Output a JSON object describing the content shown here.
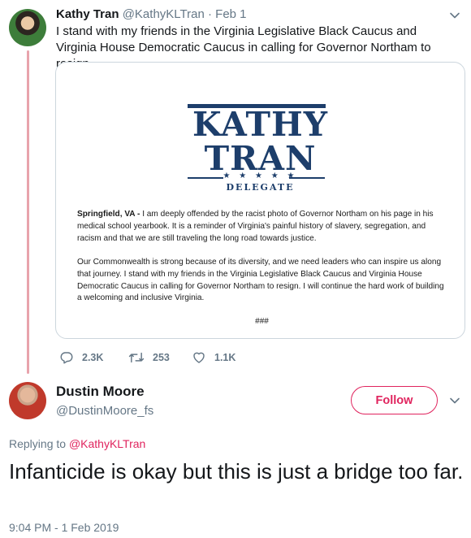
{
  "parent_tweet": {
    "author_name": "Kathy Tran",
    "author_handle": "@KathyKLTran",
    "separator": "·",
    "date": "Feb 1",
    "text": "I stand with my friends in the Virginia Legislative Black Caucus and Virginia House Democratic Caucus in calling for Governor Northam to resign.",
    "media": {
      "logo_line1": "KATHY",
      "logo_line2": "TRAN",
      "logo_stars": "★ ★ ★ ★ ★",
      "logo_subtitle": "DELEGATE",
      "dateline": "Springfield, VA -",
      "paragraph1": "I am deeply offended by the racist photo of Governor Northam on his page in his medical school yearbook. It is a reminder of Virginia's painful history of slavery, segregation, and racism and that we are still traveling the long road towards justice.",
      "paragraph2": "Our Commonwealth is strong because of its diversity, and we need leaders who can inspire us along that journey. I stand with my friends in the Virginia Legislative Black Caucus and Virginia House Democratic Caucus in calling for Governor Northam to resign. I will continue the hard work of building a welcoming and inclusive Virginia.",
      "end_mark": "###"
    },
    "actions": {
      "replies": "2.3K",
      "retweets": "253",
      "likes": "1.1K"
    }
  },
  "reply_tweet": {
    "author_name": "Dustin Moore",
    "author_handle": "@DustinMoore_fs",
    "follow_label": "Follow",
    "replying_prefix": "Replying to",
    "replying_to": "@KathyKLTran",
    "text": "Infanticide is okay but this is just a bridge too far.",
    "timestamp": "9:04 PM - 1 Feb 2019"
  },
  "colors": {
    "accent": "#e0245e",
    "thread_line": "#e8a3ac",
    "muted_text": "#657786",
    "logo_navy": "#1d3e6b"
  },
  "icons": {
    "reply": "reply-icon",
    "retweet": "retweet-icon",
    "like": "heart-icon",
    "more": "chevron-down-icon"
  }
}
